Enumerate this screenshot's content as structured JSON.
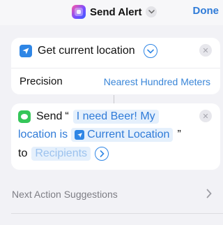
{
  "header": {
    "title": "Send Alert",
    "done_label": "Done",
    "app_icon": "shortcut-app-icon",
    "chevron_icon": "chevron-down-icon"
  },
  "location_action": {
    "title": "Get current location",
    "icon": "location-arrow-icon",
    "precision_label": "Precision",
    "precision_value": "Nearest Hundred Meters"
  },
  "send_action": {
    "icon": "messages-icon",
    "send_word": "Send",
    "open_quote": "“",
    "message_part1": "I need Beer!  My",
    "message_part2": "location is",
    "variable_name": "Current Location",
    "close_quote": "”",
    "to_word": "to",
    "recipients_placeholder": "Recipients"
  },
  "suggestions": {
    "label": "Next Action Suggestions"
  },
  "colors": {
    "accent": "#2f86e5",
    "background": "#f2f2f6",
    "card": "#ffffff",
    "messages_green": "#35c659"
  }
}
